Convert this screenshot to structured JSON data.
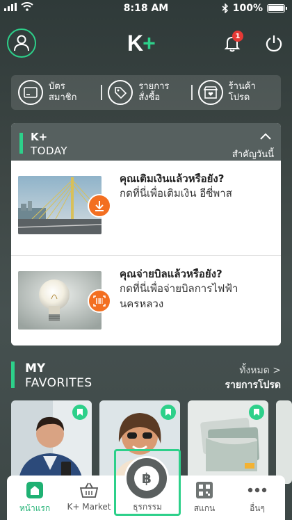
{
  "status_bar": {
    "time": "8:18 AM",
    "battery": "100%"
  },
  "header": {
    "logo_main": "K",
    "logo_plus": "+",
    "notification_count": "1"
  },
  "quick_menu": [
    {
      "label": "บัตร\nสมาชิก",
      "icon": "member-card-icon"
    },
    {
      "label": "รายการ\nสั่งซื้อ",
      "icon": "order-tag-icon"
    },
    {
      "label": "ร้านค้า\nโปรด",
      "icon": "favorite-shop-icon"
    }
  ],
  "today": {
    "title_line1": "K+",
    "title_line2": "TODAY",
    "highlight_label": "สำคัญวันนี้",
    "items": [
      {
        "title": "คุณเติมเงินแล้วหรือยัง?",
        "desc": "กดที่นี่เพื่อเติมเงิน อีซี่พาส",
        "action_icon": "download-icon"
      },
      {
        "title": "คุณจ่ายบิลแล้วหรือยัง?",
        "desc": "กดที่นี่เพื่อจ่ายบิลการไฟฟ้า นครหลวง",
        "action_icon": "barcode-scan-icon"
      }
    ]
  },
  "favorites": {
    "title_line1": "MY",
    "title_line2": "FAVORITES",
    "see_all": "ทั้งหมด >",
    "subtitle": "รายการโปรด"
  },
  "bottom_nav": [
    {
      "label": "หน้าแรก",
      "icon": "home-icon",
      "active": true
    },
    {
      "label": "K+ Market",
      "icon": "basket-icon",
      "active": false
    },
    {
      "label": "ธุรกรรม",
      "icon": "baht-icon",
      "active": false
    },
    {
      "label": "สแกน",
      "icon": "qr-scan-icon",
      "active": false
    },
    {
      "label": "อื่นๆ",
      "icon": "more-icon",
      "active": false
    }
  ],
  "colors": {
    "accent": "#2dd08a",
    "action_orange": "#f36f21",
    "badge_red": "#e53935"
  }
}
